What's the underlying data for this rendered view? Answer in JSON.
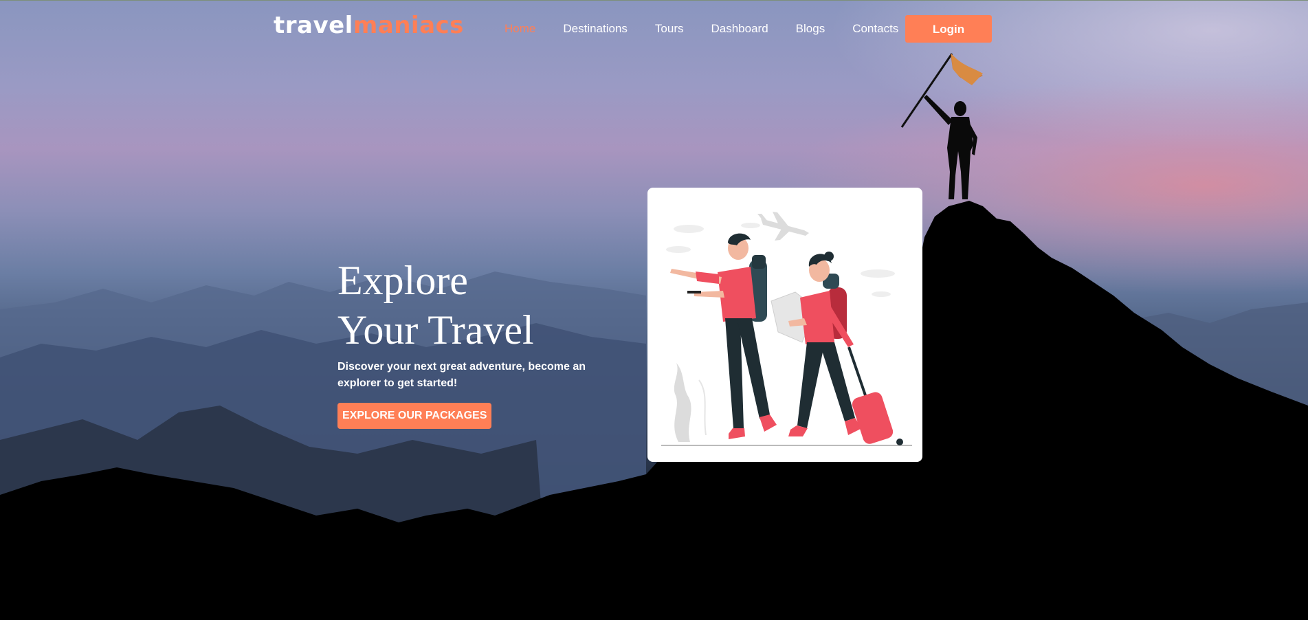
{
  "brand": {
    "logo_part1": "travel",
    "logo_part2": "maniacs"
  },
  "nav": {
    "items": [
      {
        "label": "Home",
        "active": true
      },
      {
        "label": "Destinations"
      },
      {
        "label": "Tours"
      },
      {
        "label": "Dashboard"
      },
      {
        "label": "Blogs"
      },
      {
        "label": "Contacts"
      }
    ],
    "login_label": "Login"
  },
  "hero": {
    "headline_line1": "Explore",
    "headline_line2": "Your Travel",
    "subtitle": "Discover your next great adventure, become an explorer to get started!",
    "cta_label": "EXPLORE OUR PACKAGES"
  },
  "colors": {
    "accent": "#ff7f56",
    "text": "#ffffff"
  },
  "icons": {
    "illustration": "travelers-illustration",
    "background": "mountain-summit-flag-silhouette"
  }
}
